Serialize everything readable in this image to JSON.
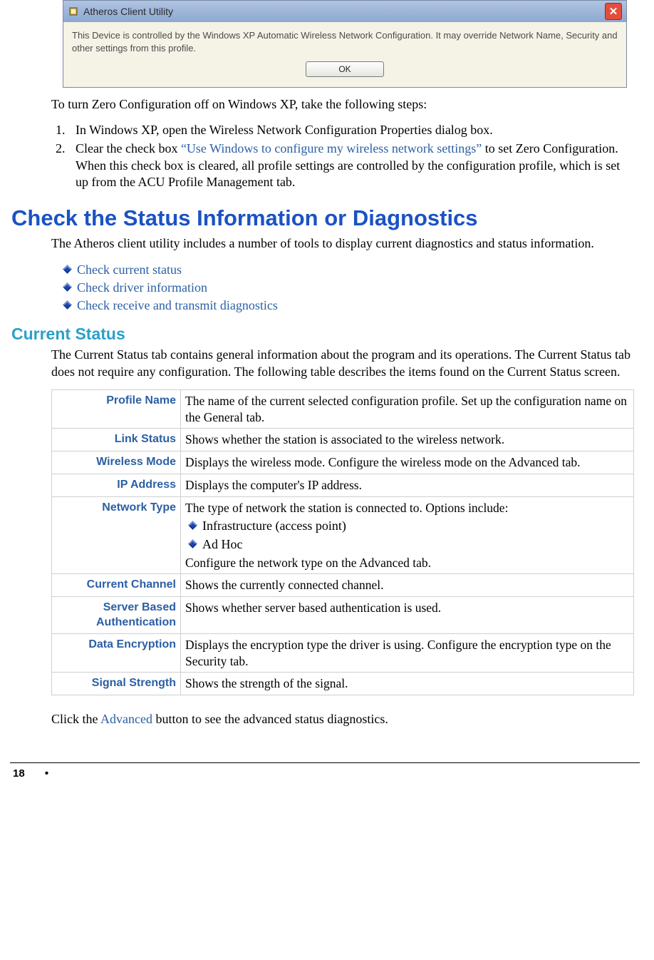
{
  "dialog": {
    "title": "Atheros Client Utility",
    "message": "This Device is controlled by the Windows XP Automatic Wireless Network Configuration. It may override Network Name, Security and other settings from this profile.",
    "ok_label": "OK"
  },
  "intro_paragraph": "To turn Zero Configuration off on Windows XP, take the following steps:",
  "steps": {
    "s1": "In Windows XP, open the Wireless Network Configuration Properties dialog box.",
    "s2_prefix": "Clear the check box ",
    "s2_quoted": "“Use Windows to configure my wireless network settings”",
    "s2_suffix": " to set Zero Configuration.  When this check box is cleared, all profile settings are controlled by the configuration profile, which is set up from the ACU Profile Management tab."
  },
  "heading_main": "Check the Status Information or Diagnostics",
  "main_paragraph": "The Atheros client utility includes a number of tools to display current diagnostics and status information.",
  "links": {
    "l1": "Check current status",
    "l2": "Check driver information",
    "l3": "Check receive and transmit diagnostics"
  },
  "heading_sub": "Current Status",
  "sub_paragraph": "The Current Status tab contains general information about the program and its operations. The Current Status tab does not require any configuration. The following table describes the items found on the Current Status screen.",
  "table": {
    "r1": {
      "label": "Profile Name",
      "desc": "The name of the current selected configuration profile.  Set up the configuration name on the General tab."
    },
    "r2": {
      "label": "Link Status",
      "desc": "Shows whether the station is associated to the wireless network."
    },
    "r3": {
      "label": "Wireless Mode",
      "desc": "Displays the wireless mode.  Configure the wireless mode on the Advanced tab."
    },
    "r4": {
      "label": "IP Address",
      "desc": "Displays the computer's IP address."
    },
    "r5": {
      "label": "Network Type",
      "desc_intro": "The type of network the station is connected to.  Options include:",
      "opt1": "Infrastructure (access point)",
      "opt2": "Ad Hoc",
      "desc_outro": "Configure the network type on the Advanced tab."
    },
    "r6": {
      "label": "Current Channel",
      "desc": "Shows the currently connected channel."
    },
    "r7": {
      "label": "Server Based Authentication",
      "desc": "Shows whether server based authentication is used."
    },
    "r8": {
      "label": "Data Encryption",
      "desc": "Displays the encryption type the driver is using.   Configure the encryption type on the Security tab."
    },
    "r9": {
      "label": "Signal Strength",
      "desc": "Shows the strength of the signal."
    }
  },
  "closing": {
    "prefix": "Click the ",
    "link": "Advanced",
    "suffix": " button to see the advanced status diagnostics."
  },
  "footer": {
    "page_number": "18",
    "bullet": "•"
  }
}
